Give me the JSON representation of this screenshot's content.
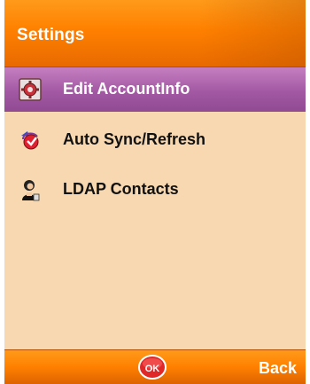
{
  "header": {
    "title": "Settings"
  },
  "menu": {
    "items": [
      {
        "label": "Edit AccountInfo",
        "icon": "account-settings-icon",
        "selected": true
      },
      {
        "label": "Auto Sync/Refresh",
        "icon": "sync-icon",
        "selected": false
      },
      {
        "label": "LDAP Contacts",
        "icon": "contact-person-icon",
        "selected": false
      }
    ]
  },
  "softkeys": {
    "center": "OK",
    "right": "Back"
  },
  "colors": {
    "accent_orange": "#ff8000",
    "content_bg": "#f7d8b1",
    "selection_purple": "#a358a3"
  }
}
